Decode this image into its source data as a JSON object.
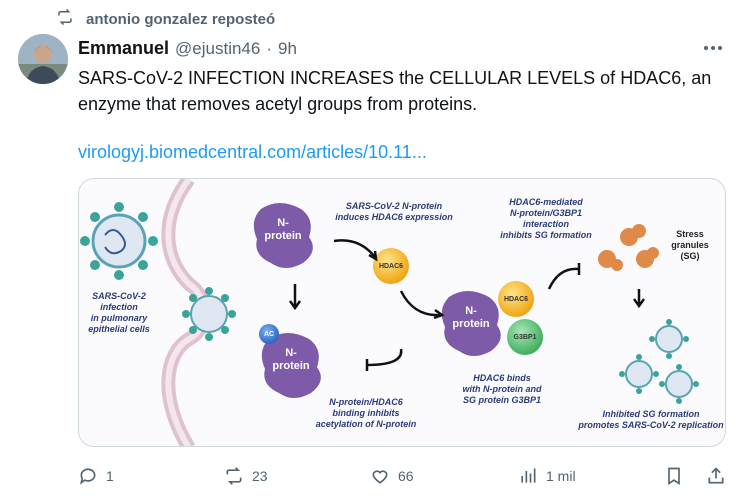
{
  "repost": {
    "text": "antonio gonzalez reposteó"
  },
  "post": {
    "author_name": "Emmanuel",
    "handle": "@ejustin46",
    "separator": "·",
    "time": "9h",
    "text": "SARS-CoV-2 INFECTION INCREASES the CELLULAR LEVELS of HDAC6, an enzyme that removes acetyl groups from proteins.",
    "link": "virologyj.biomedcentral.com/articles/10.11..."
  },
  "figure": {
    "label_infection": "SARS-CoV-2\ninfection\nin pulmonary\nepithelial cells",
    "n_protein_1": "N-\nprotein",
    "n_protein_2": "N-\nprotein",
    "n_protein_3": "N-\nprotein",
    "ac": "AC",
    "hdac6_top": "HDAC6",
    "hdac6_right": "HDAC6",
    "g3bp1": "G3BP1",
    "induces": "SARS-CoV-2 N-protein\ninduces HDAC6 expression",
    "binding_inhibits": "N-protein/HDAC6\nbinding inhibits\nacetylation of N-protein",
    "binds": "HDAC6 binds\nwith N-protein and\nSG protein G3BP1",
    "mediated": "HDAC6-mediated\nN-protein/G3BP1\ninteraction\ninhibits SG formation",
    "stress": "Stress\ngranules\n(SG)",
    "inhibited": "Inhibited SG formation\npromotes SARS-CoV-2 replication"
  },
  "actions": {
    "replies": "1",
    "reposts": "23",
    "likes": "66",
    "views": "1 mil"
  },
  "colors": {
    "link": "#1d9bf0",
    "muted": "#536471",
    "protein": "#7e5ba8",
    "hdac6": "#f5b21b",
    "g3bp1": "#5ec27a"
  }
}
